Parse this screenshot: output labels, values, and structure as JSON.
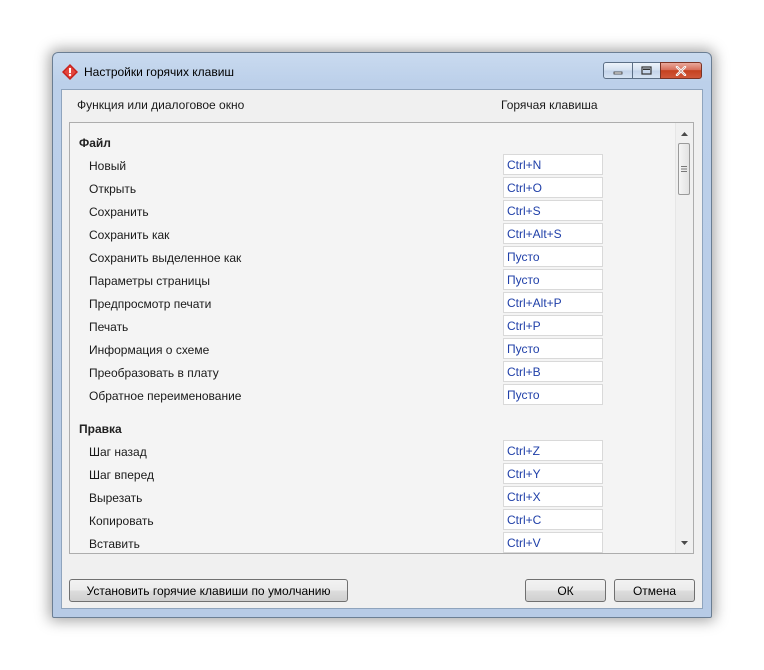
{
  "window": {
    "title": "Настройки горячих клавиш",
    "accent_color": "#c5411f"
  },
  "columns": {
    "function": "Функция или диалоговое окно",
    "hotkey": "Горячая клавиша"
  },
  "sections": [
    {
      "title": "Файл",
      "items": [
        {
          "label": "Новый",
          "key": "Ctrl+N"
        },
        {
          "label": "Открыть",
          "key": "Ctrl+O"
        },
        {
          "label": "Сохранить",
          "key": "Ctrl+S"
        },
        {
          "label": "Сохранить как",
          "key": "Ctrl+Alt+S"
        },
        {
          "label": "Сохранить выделенное как",
          "key": "Пусто"
        },
        {
          "label": "Параметры страницы",
          "key": "Пусто"
        },
        {
          "label": "Предпросмотр печати",
          "key": "Ctrl+Alt+P"
        },
        {
          "label": "Печать",
          "key": "Ctrl+P"
        },
        {
          "label": "Информация о схеме",
          "key": "Пусто"
        },
        {
          "label": "Преобразовать в плату",
          "key": "Ctrl+B"
        },
        {
          "label": "Обратное переименование",
          "key": "Пусто"
        }
      ]
    },
    {
      "title": "Правка",
      "items": [
        {
          "label": "Шаг назад",
          "key": "Ctrl+Z"
        },
        {
          "label": "Шаг вперед",
          "key": "Ctrl+Y"
        },
        {
          "label": "Вырезать",
          "key": "Ctrl+X"
        },
        {
          "label": "Копировать",
          "key": "Ctrl+C"
        },
        {
          "label": "Вставить",
          "key": "Ctrl+V"
        }
      ]
    }
  ],
  "buttons": {
    "reset_defaults": "Установить горячие клавиши по умолчанию",
    "ok": "ОК",
    "cancel": "Отмена"
  },
  "icons": {
    "app": "app-logo-icon",
    "minimize": "minimize-icon",
    "maximize": "maximize-icon",
    "close": "close-icon"
  }
}
